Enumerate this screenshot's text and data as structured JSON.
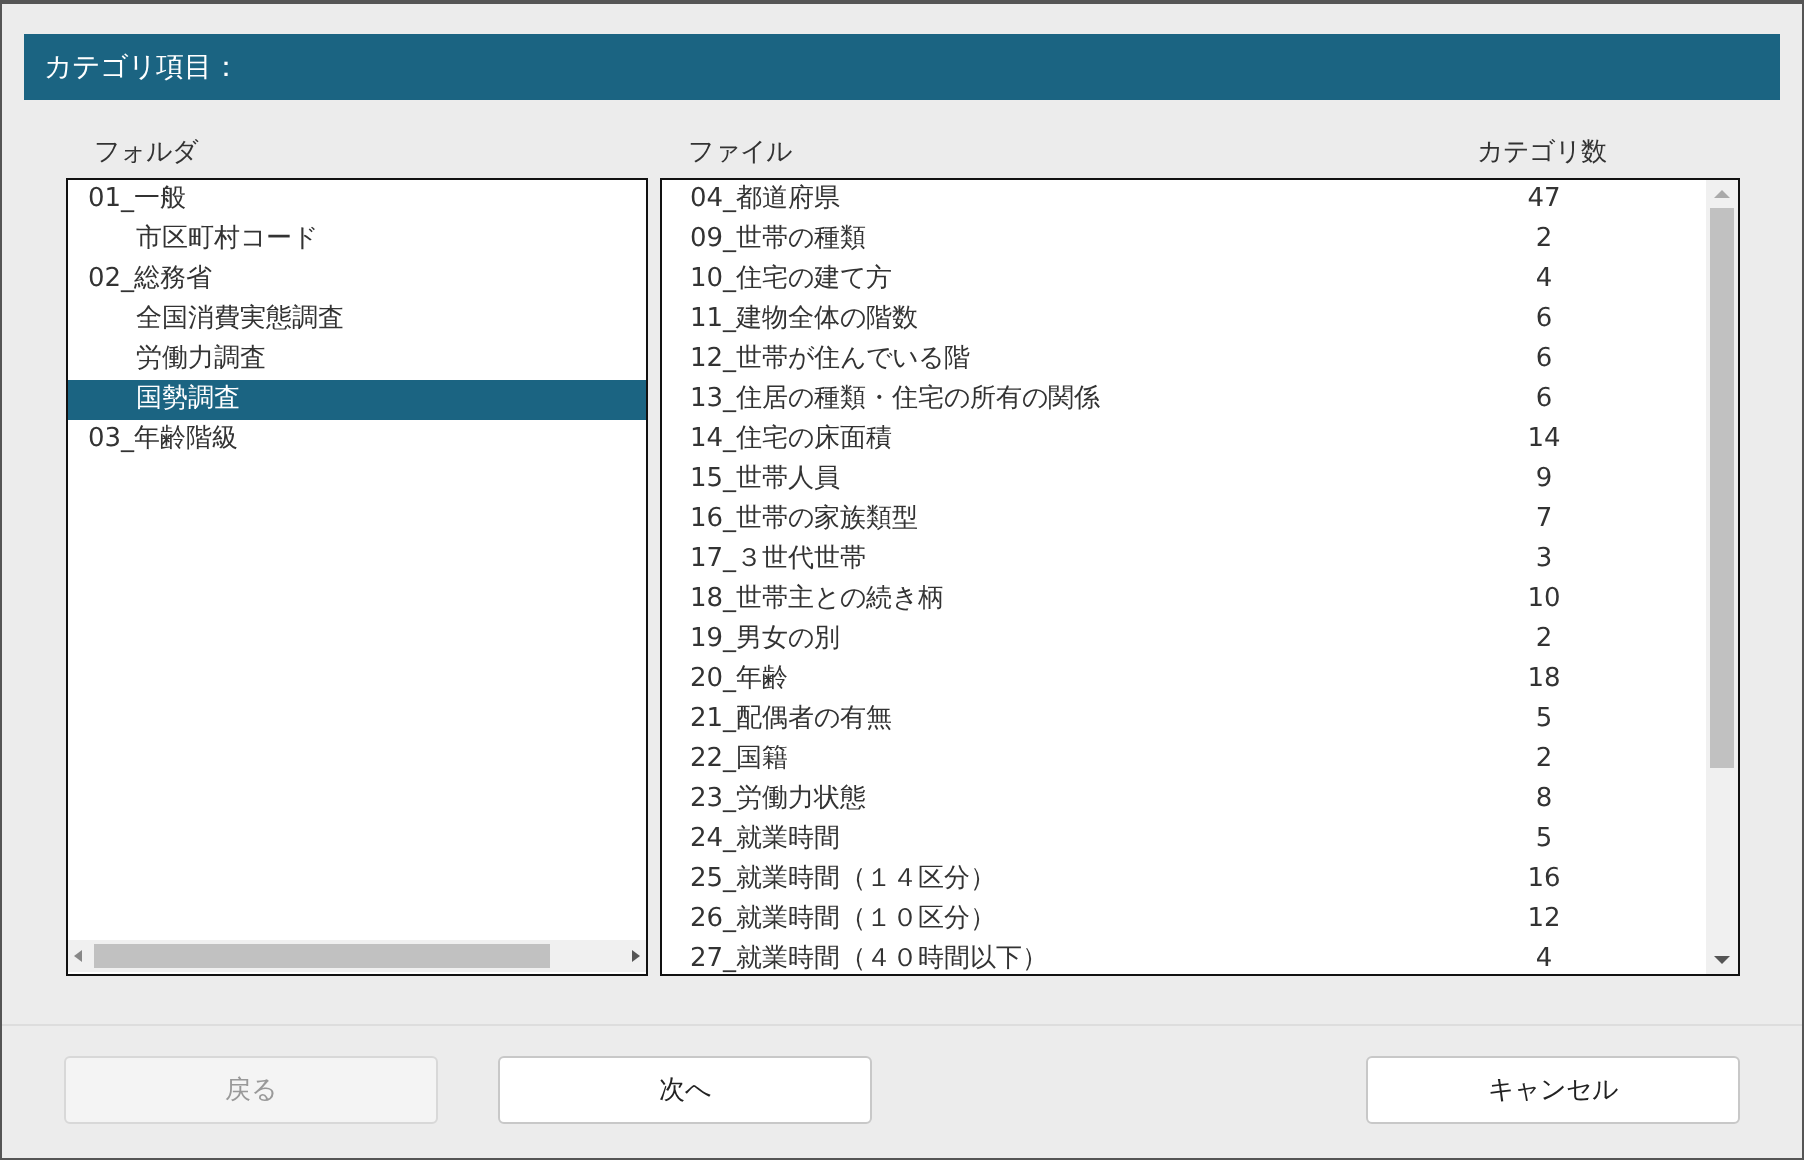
{
  "header": {
    "title": "カテゴリ項目："
  },
  "folder_pane": {
    "heading": "フォルダ",
    "items": [
      {
        "label": "01_一般",
        "selected": false,
        "children": [
          {
            "label": "市区町村コード",
            "selected": false
          }
        ]
      },
      {
        "label": "02_総務省",
        "selected": false,
        "children": [
          {
            "label": "全国消費実態調査",
            "selected": false
          },
          {
            "label": "労働力調査",
            "selected": false
          },
          {
            "label": "国勢調査",
            "selected": true
          }
        ]
      },
      {
        "label": "03_年齢階級",
        "selected": false
      }
    ]
  },
  "file_pane": {
    "columns": [
      "ファイル",
      "カテゴリ数"
    ],
    "rows": [
      {
        "name": "04_都道府県",
        "count": "47"
      },
      {
        "name": "09_世帯の種類",
        "count": "2"
      },
      {
        "name": "10_住宅の建て方",
        "count": "4"
      },
      {
        "name": "11_建物全体の階数",
        "count": "6"
      },
      {
        "name": "12_世帯が住んでいる階",
        "count": "6"
      },
      {
        "name": "13_住居の種類・住宅の所有の関係",
        "count": "6"
      },
      {
        "name": "14_住宅の床面積",
        "count": "14"
      },
      {
        "name": "15_世帯人員",
        "count": "9"
      },
      {
        "name": "16_世帯の家族類型",
        "count": "7"
      },
      {
        "name": "17_３世代世帯",
        "count": "3"
      },
      {
        "name": "18_世帯主との続き柄",
        "count": "10"
      },
      {
        "name": "19_男女の別",
        "count": "2"
      },
      {
        "name": "20_年齢",
        "count": "18"
      },
      {
        "name": "21_配偶者の有無",
        "count": "5"
      },
      {
        "name": "22_国籍",
        "count": "2"
      },
      {
        "name": "23_労働力状態",
        "count": "8"
      },
      {
        "name": "24_就業時間",
        "count": "5"
      },
      {
        "name": "25_就業時間（１４区分）",
        "count": "16"
      },
      {
        "name": "26_就業時間（１０区分）",
        "count": "12"
      },
      {
        "name": "27_就業時間（４０時間以下）",
        "count": "4"
      }
    ]
  },
  "buttons": [
    {
      "label": "戻る",
      "disabled": true
    },
    {
      "label": "次へ",
      "disabled": false
    },
    {
      "label": "キャンセル",
      "disabled": false
    }
  ]
}
